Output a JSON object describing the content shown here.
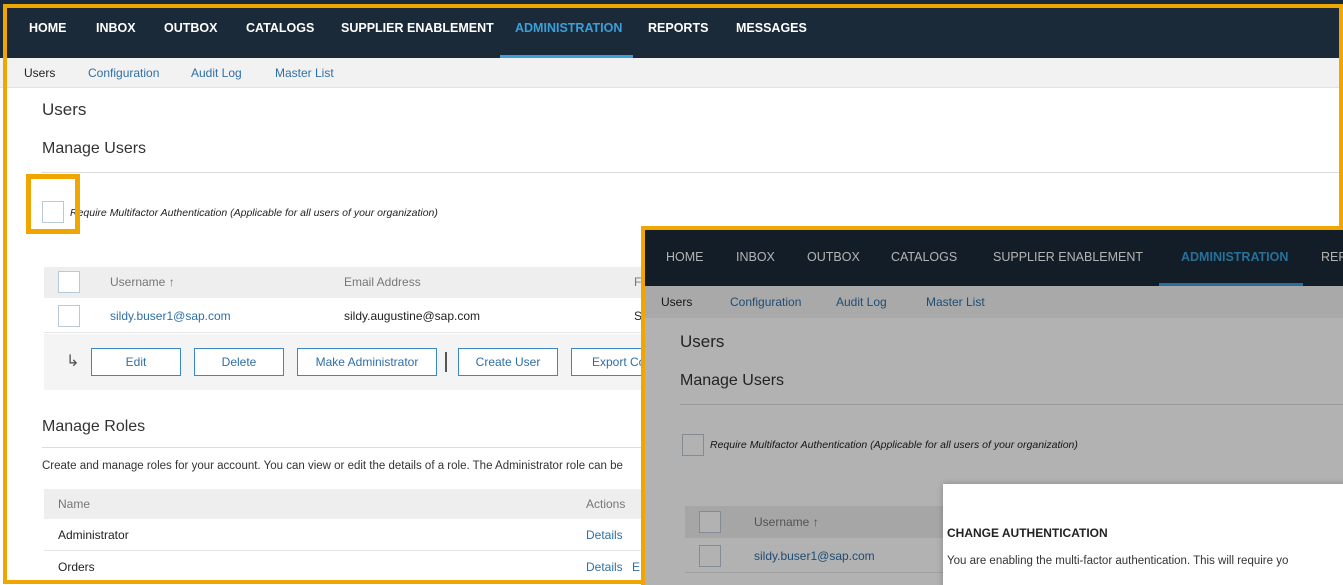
{
  "back": {
    "topnav": [
      "HOME",
      "INBOX",
      "OUTBOX",
      "CATALOGS",
      "SUPPLIER ENABLEMENT",
      "ADMINISTRATION",
      "REPORTS",
      "MESSAGES"
    ],
    "subnav": [
      "Users",
      "Configuration",
      "Audit Log",
      "Master List"
    ],
    "page_title": "Users",
    "section_title": "Manage Users",
    "mfa_label": "Require Multifactor Authentication (Applicable for all users of your organization)",
    "table": {
      "headers": [
        "Username ↑",
        "Email Address",
        "F"
      ],
      "row": [
        "sildy.buser1@sap.com",
        "sildy.augustine@sap.com",
        "S"
      ]
    },
    "actions": {
      "arrow": "↳",
      "edit": "Edit",
      "delete": "Delete",
      "make_admin": "Make Administrator",
      "create_user": "Create User",
      "export": "Export Co"
    },
    "roles": {
      "title": "Manage Roles",
      "description": "Create and manage roles for your account. You can view or edit the details of a role. The Administrator role can be",
      "headers": [
        "Name",
        "Actions"
      ],
      "rows": [
        {
          "name": "Administrator",
          "action": "Details",
          "extra": ""
        },
        {
          "name": "Orders",
          "action": "Details",
          "extra": "E"
        }
      ]
    }
  },
  "front": {
    "topnav": [
      "HOME",
      "INBOX",
      "OUTBOX",
      "CATALOGS",
      "SUPPLIER ENABLEMENT",
      "ADMINISTRATION",
      "REPO"
    ],
    "subnav": [
      "Users",
      "Configuration",
      "Audit Log",
      "Master List"
    ],
    "page_title": "Users",
    "section_title": "Manage Users",
    "mfa_label": "Require Multifactor Authentication (Applicable for all users of your organization)",
    "table_header": "Username ↑",
    "table_row": "sildy.buser1@sap.com",
    "modal": {
      "title": "CHANGE AUTHENTICATION",
      "text": "You are enabling the multi-factor authentication. This will require yo"
    }
  },
  "colors": {
    "highlight": "#f0a500",
    "nav_bg": "#1b2a38",
    "accent": "#3b9fd9",
    "link": "#2f6fa7"
  }
}
